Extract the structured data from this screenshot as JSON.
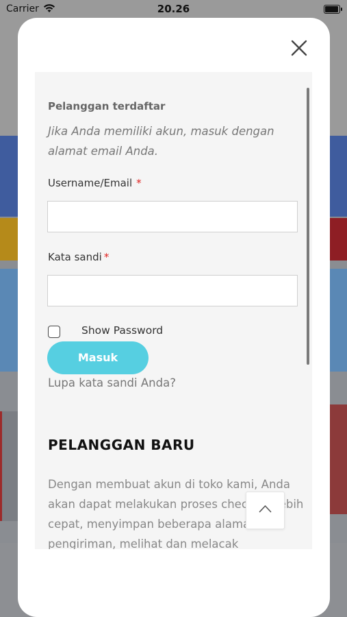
{
  "status_bar": {
    "carrier": "Carrier",
    "time": "20.26"
  },
  "modal": {
    "registered": {
      "heading": "Pelanggan terdaftar",
      "intro": "Jika Anda memiliki akun, masuk dengan alamat email Anda.",
      "username_label": "Username/Email",
      "password_label": "Kata sandi",
      "required_mark": "*",
      "username_value": "",
      "password_value": "",
      "show_password_label": "Show Password",
      "login_button": "Masuk",
      "forgot_link": "Lupa kata sandi Anda?"
    },
    "new_customer": {
      "heading": "PELANGGAN BARU",
      "description": "Dengan membuat akun di toko kami, Anda akan dapat melakukan proses checkout lebih cepat, menyimpan beberapa alamat pengiriman, melihat dan melacak"
    },
    "close_icon": "close-icon",
    "scroll_top_icon": "chevron-up-icon"
  },
  "colors": {
    "login_button": "#56cfe1",
    "required": "#e0201e",
    "panel_bg": "#f5f5f5"
  }
}
